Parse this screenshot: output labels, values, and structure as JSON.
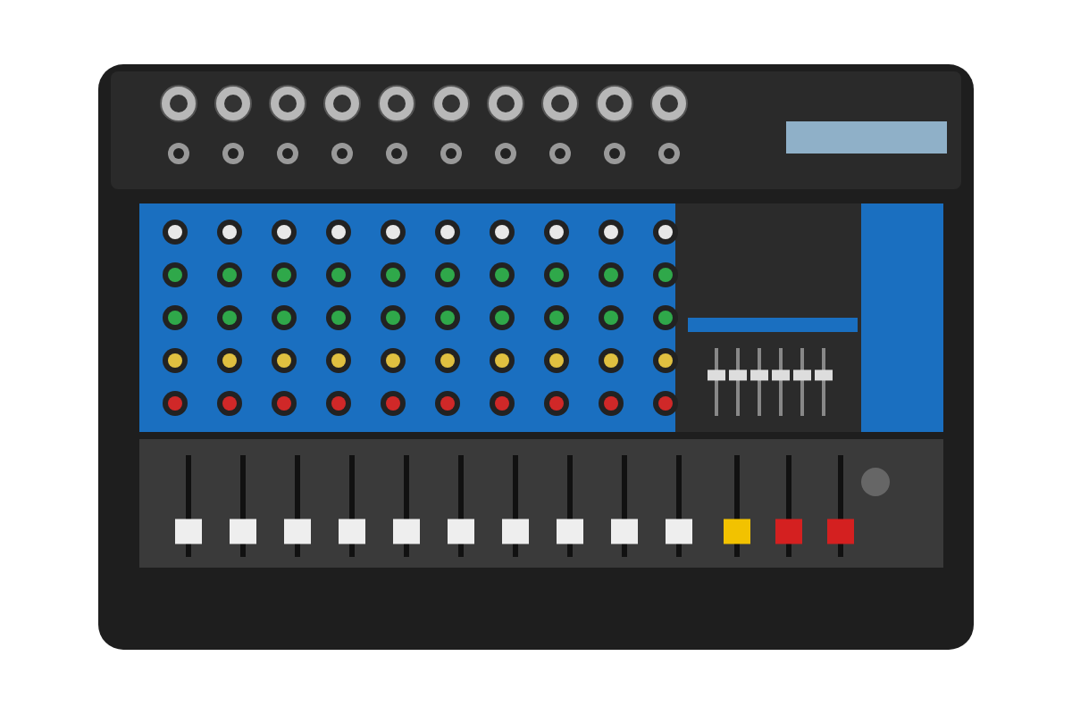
{
  "product_photo": {
    "kind": "audio-mixer",
    "channels": [
      {
        "level": 0.25
      },
      {
        "level": 0.25
      },
      {
        "level": 0.25
      },
      {
        "level": 0.25
      },
      {
        "level": 0.25
      },
      {
        "level": 0.25
      },
      {
        "level": 0.25
      },
      {
        "level": 0.25
      },
      {
        "level": 0.25
      },
      {
        "level": 0.25
      }
    ],
    "equalizer": [
      {
        "level": 0.6
      },
      {
        "level": 0.6
      },
      {
        "level": 0.6
      },
      {
        "level": 0.6
      },
      {
        "level": 0.6
      },
      {
        "level": 0.6
      }
    ],
    "masters": [
      {
        "color": "#f2c200",
        "level": 0.25
      },
      {
        "color": "#d42020",
        "level": 0.25
      },
      {
        "color": "#d42020",
        "level": 0.25
      }
    ]
  }
}
